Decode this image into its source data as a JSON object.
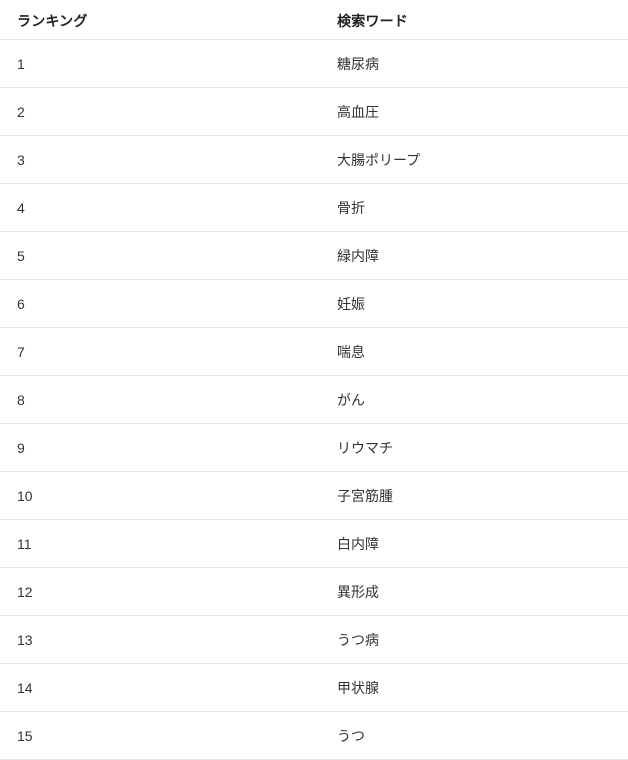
{
  "table": {
    "columns": [
      {
        "key": "rank",
        "label": "ランキング"
      },
      {
        "key": "word",
        "label": "検索ワード"
      }
    ],
    "rows": [
      {
        "rank": "1",
        "word": "糖尿病"
      },
      {
        "rank": "2",
        "word": "高血圧"
      },
      {
        "rank": "3",
        "word": "大腸ポリープ"
      },
      {
        "rank": "4",
        "word": "骨折"
      },
      {
        "rank": "5",
        "word": "緑内障"
      },
      {
        "rank": "6",
        "word": "妊娠"
      },
      {
        "rank": "7",
        "word": "喘息"
      },
      {
        "rank": "8",
        "word": "がん"
      },
      {
        "rank": "9",
        "word": "リウマチ"
      },
      {
        "rank": "10",
        "word": "子宮筋腫"
      },
      {
        "rank": "11",
        "word": "白内障"
      },
      {
        "rank": "12",
        "word": "異形成"
      },
      {
        "rank": "13",
        "word": "うつ病"
      },
      {
        "rank": "14",
        "word": "甲状腺"
      },
      {
        "rank": "15",
        "word": "うつ"
      }
    ]
  },
  "colors": {
    "background": "#ffffff",
    "header_text": "#222222",
    "body_text": "#333333",
    "divider": "#e6e6e6"
  }
}
